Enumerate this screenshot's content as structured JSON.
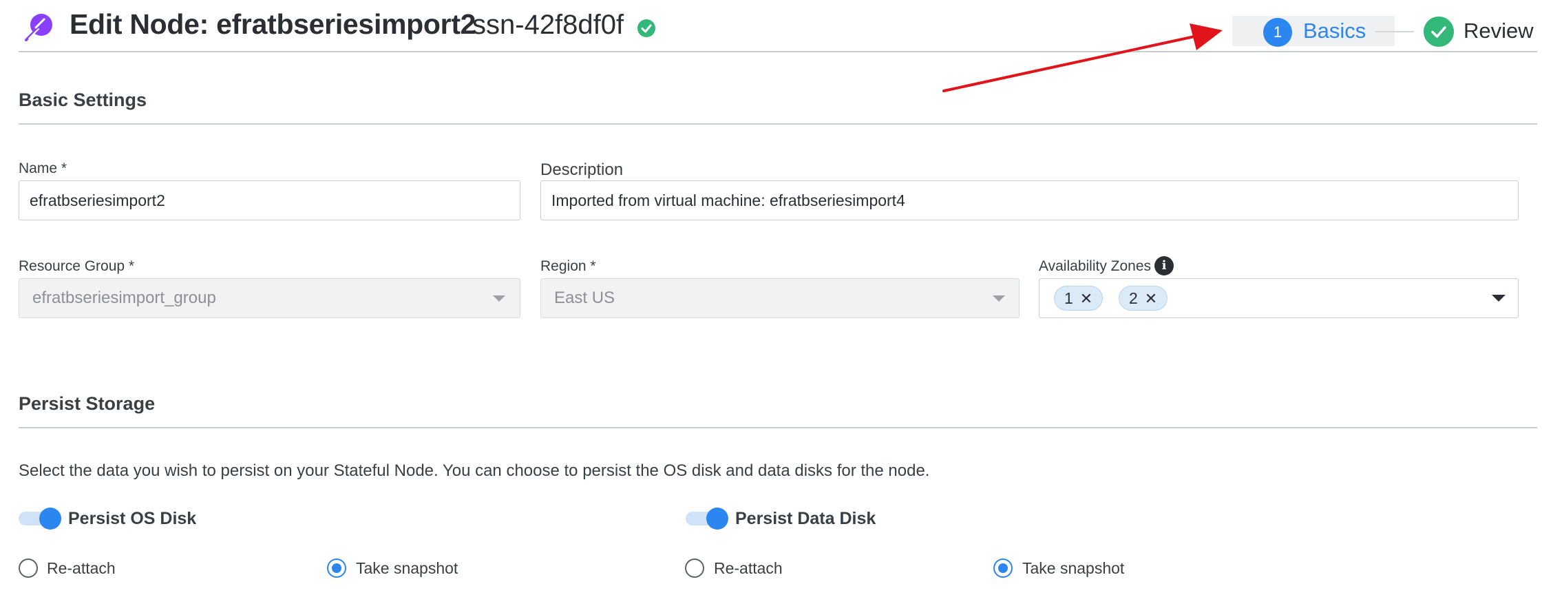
{
  "header": {
    "title": "Edit Node: efratbseriesimport2",
    "node_id": "ssn-42f8df0f",
    "status_icon": "check-circle-icon",
    "status_color": "#33b87a"
  },
  "stepper": {
    "steps": [
      {
        "number": "1",
        "label": "Basics",
        "state": "active"
      },
      {
        "label": "Review",
        "state": "complete"
      }
    ],
    "accent": "#2b86f0"
  },
  "basic_settings": {
    "title": "Basic Settings",
    "name": {
      "label": "Name *",
      "value": "efratbseriesimport2"
    },
    "description": {
      "label": "Description",
      "value": "Imported from virtual machine: efratbseriesimport4"
    },
    "resource_group": {
      "label": "Resource Group *",
      "value": "efratbseriesimport_group",
      "disabled": true
    },
    "region": {
      "label": "Region *",
      "value": "East US",
      "disabled": true
    },
    "availability_zones": {
      "label": "Availability Zones",
      "info_icon": "info-icon",
      "selected": [
        "1",
        "2"
      ]
    }
  },
  "persist_storage": {
    "title": "Persist Storage",
    "description": "Select the data you wish to persist on your Stateful Node. You can choose to persist the OS disk and data disks for the node.",
    "os_disk": {
      "label": "Persist OS Disk",
      "enabled": true,
      "options": [
        "Re-attach",
        "Take snapshot"
      ],
      "selected": "Take snapshot"
    },
    "data_disk": {
      "label": "Persist Data Disk",
      "enabled": true,
      "options": [
        "Re-attach",
        "Take snapshot"
      ],
      "selected": "Take snapshot"
    }
  },
  "annotation": {
    "arrow_color": "#e0141a"
  }
}
